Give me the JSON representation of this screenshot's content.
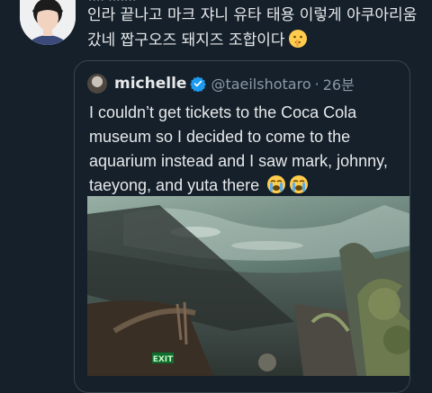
{
  "tweet": {
    "author_line_partial": "···· ·······",
    "text": "인라 끝나고 마크 쟈니 유타 태용 이렇게 아쿠아리움 갔네 짭구오즈 돼지즈 조합이다",
    "text_emoji": "shushing-face-emoji"
  },
  "quote": {
    "name": "michelle",
    "verified": true,
    "handle": "@taeilshotaro",
    "separator": "·",
    "time": "26분",
    "text": "I couldn’t get tickets to the Coca Cola museum so I decided to come to the aquarium instead and I saw mark, johnny, taeyong, and yuta there",
    "text_emojis": [
      "loudly-crying-face-emoji",
      "loudly-crying-face-emoji"
    ],
    "photo_sign": "EXIT"
  },
  "colors": {
    "background": "#15202b",
    "text": "#e7e9ea",
    "muted": "#8b98a5",
    "border": "#38444d",
    "verified": "#1d9bf0"
  }
}
